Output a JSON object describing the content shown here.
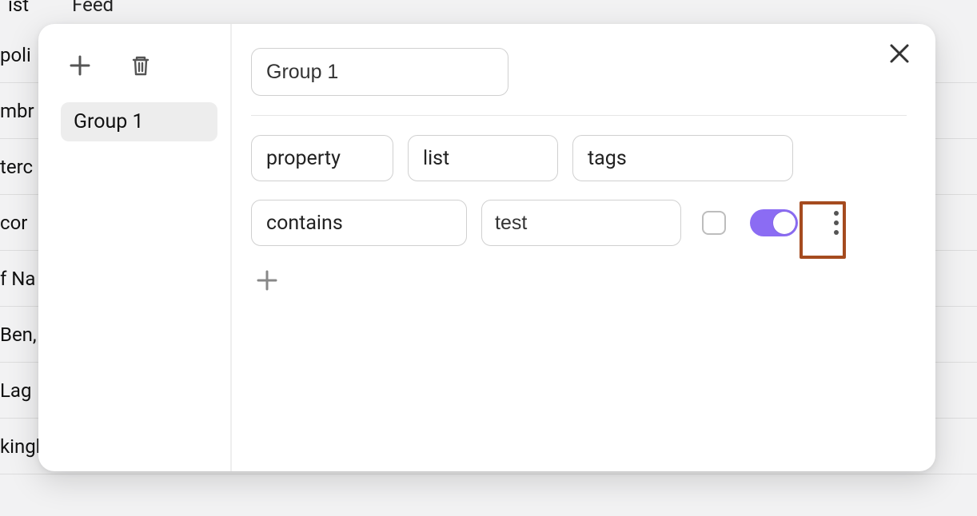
{
  "background": {
    "tabs": [
      {
        "label": "ist",
        "active": true
      },
      {
        "label": "Feed",
        "active": false
      }
    ],
    "rows": [
      "poli",
      "mbr",
      "terc",
      "cor",
      "f Na",
      "Ben,",
      "Lag",
      "kingham Palace, London, England"
    ]
  },
  "modal": {
    "group_name_value": "Group 1",
    "sidebar": {
      "items": [
        {
          "label": "Group 1",
          "selected": true
        }
      ]
    },
    "condition_row1": {
      "source": "property",
      "list": "list",
      "column": "tags"
    },
    "condition_row2": {
      "operator": "contains",
      "value": "test",
      "checkbox": false,
      "toggle": true
    }
  }
}
